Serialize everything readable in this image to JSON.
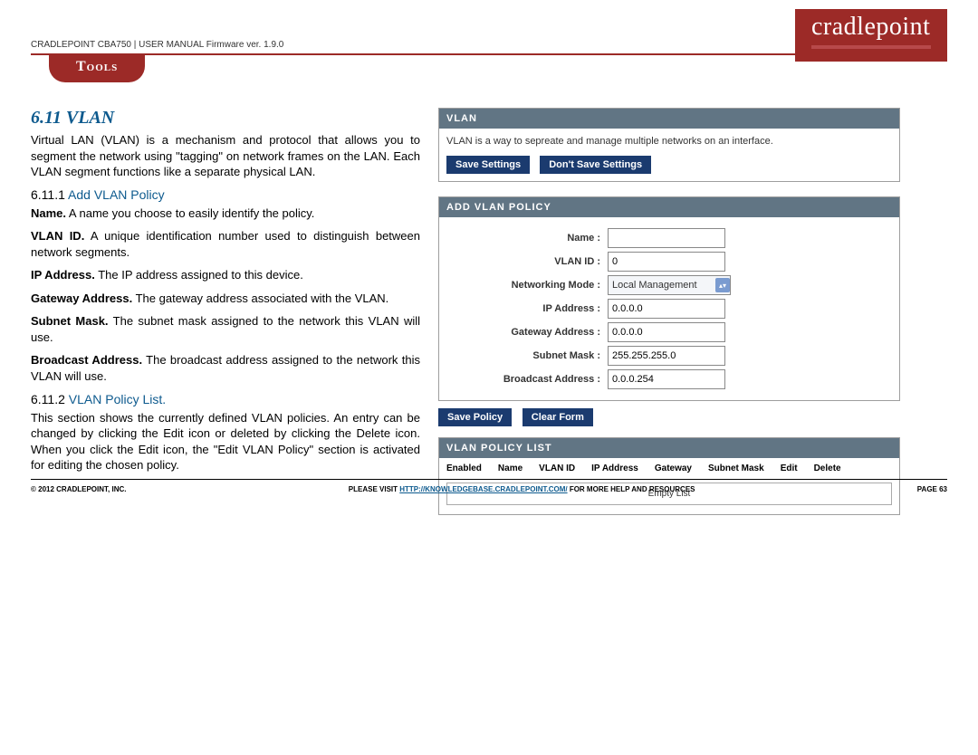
{
  "header": {
    "breadcrumb": "CRADLEPOINT CBA750 | USER MANUAL Firmware ver. 1.9.0",
    "logo": "cradlepoint",
    "pill": "Tools"
  },
  "left": {
    "title": "6.11 VLAN",
    "intro": "Virtual LAN (VLAN) is a mechanism and protocol that allows you to segment the network using \"tagging\" on network frames on the LAN. Each VLAN segment functions like a separate physical LAN.",
    "sub1_num": "6.11.1",
    "sub1_title": "Add VLAN Policy",
    "name_b": "Name.",
    "name_t": " A name you choose to easily identify the policy.",
    "vlanid_b": "VLAN ID.",
    "vlanid_t": " A unique identification number used to distinguish between network segments.",
    "ip_b": "IP Address.",
    "ip_t": " The IP address assigned to this device.",
    "gw_b": "Gateway Address.",
    "gw_t": " The gateway address associated with the VLAN.",
    "sm_b": "Subnet Mask.",
    "sm_t": " The subnet mask assigned to the network this VLAN will use.",
    "bc_b": "Broadcast Address.",
    "bc_t": " The broadcast address assigned to the network this VLAN will use.",
    "sub2_num": "6.11.2",
    "sub2_title": "VLAN Policy List.",
    "sub2_body": "This section shows the currently defined VLAN policies. An entry can be changed by clicking the Edit icon or deleted by clicking the Delete icon. When you click the Edit icon, the \"Edit VLAN Policy\" section is activated for editing the chosen policy."
  },
  "right": {
    "panel1_title": "VLAN",
    "panel1_desc": "VLAN is a way to sepreate and manage multiple networks on an interface.",
    "save": "Save Settings",
    "dont_save": "Don't Save Settings",
    "panel2_title": "ADD VLAN POLICY",
    "fields": {
      "name_label": "Name :",
      "name_value": "",
      "vlanid_label": "VLAN ID :",
      "vlanid_value": "0",
      "mode_label": "Networking Mode :",
      "mode_value": "Local Management",
      "ip_label": "IP Address :",
      "ip_value": "0.0.0.0",
      "gw_label": "Gateway Address :",
      "gw_value": "0.0.0.0",
      "sm_label": "Subnet Mask :",
      "sm_value": "255.255.255.0",
      "bc_label": "Broadcast Address :",
      "bc_value": "0.0.0.254"
    },
    "save_policy": "Save Policy",
    "clear_form": "Clear Form",
    "panel3_title": "VLAN POLICY LIST",
    "cols": {
      "enabled": "Enabled",
      "name": "Name",
      "vlanid": "VLAN ID",
      "ip": "IP Address",
      "gateway": "Gateway",
      "subnet": "Subnet Mask",
      "edit": "Edit",
      "delete": "Delete"
    },
    "empty": "Empty List"
  },
  "footer": {
    "left": "© 2012 CRADLEPOINT, INC.",
    "c1": "PLEASE VISIT ",
    "link": "HTTP://KNOWLEDGEBASE.CRADLEPOINT.COM/",
    "c2": " FOR MORE HELP AND RESOURCES",
    "right": "PAGE 63"
  }
}
